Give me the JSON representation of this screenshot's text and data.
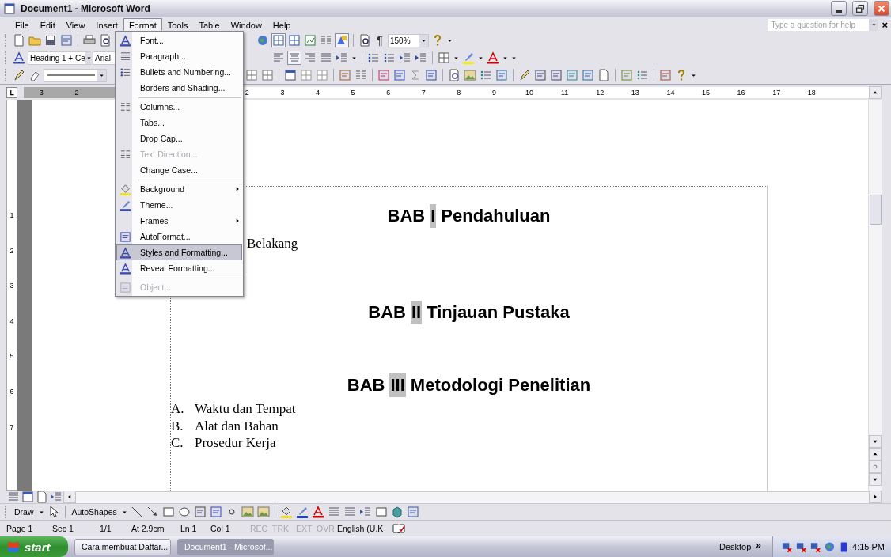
{
  "window": {
    "title": "Document1 - Microsoft Word"
  },
  "menu_bar": [
    {
      "label": "File",
      "selected": false
    },
    {
      "label": "Edit",
      "selected": false
    },
    {
      "label": "View",
      "selected": false
    },
    {
      "label": "Insert",
      "selected": false
    },
    {
      "label": "Format",
      "selected": true
    },
    {
      "label": "Tools",
      "selected": false
    },
    {
      "label": "Table",
      "selected": false
    },
    {
      "label": "Window",
      "selected": false
    },
    {
      "label": "Help",
      "selected": false
    }
  ],
  "help_box": {
    "placeholder": "Type a question for help",
    "close": "×"
  },
  "standard_toolbar": {
    "marks": "¶",
    "zoom": "150%"
  },
  "formatting_toolbar": {
    "style": "Heading 1 + Ce",
    "font": "Arial"
  },
  "format_menu": [
    {
      "label": "Font...",
      "disabled": false,
      "selected": false,
      "submenu": false,
      "separator_before": false
    },
    {
      "label": "Paragraph...",
      "disabled": false,
      "selected": false,
      "submenu": false,
      "separator_before": false
    },
    {
      "label": "Bullets and Numbering...",
      "disabled": false,
      "selected": false,
      "submenu": false,
      "separator_before": false
    },
    {
      "label": "Borders and Shading...",
      "disabled": false,
      "selected": false,
      "submenu": false,
      "separator_before": false
    },
    {
      "label": "Columns...",
      "disabled": false,
      "selected": false,
      "submenu": false,
      "separator_before": true
    },
    {
      "label": "Tabs...",
      "disabled": false,
      "selected": false,
      "submenu": false,
      "separator_before": false
    },
    {
      "label": "Drop Cap...",
      "disabled": false,
      "selected": false,
      "submenu": false,
      "separator_before": false
    },
    {
      "label": "Text Direction...",
      "disabled": true,
      "selected": false,
      "submenu": false,
      "separator_before": false
    },
    {
      "label": "Change Case...",
      "disabled": false,
      "selected": false,
      "submenu": false,
      "separator_before": false
    },
    {
      "label": "Background",
      "disabled": false,
      "selected": false,
      "submenu": true,
      "separator_before": true
    },
    {
      "label": "Theme...",
      "disabled": false,
      "selected": false,
      "submenu": false,
      "separator_before": false
    },
    {
      "label": "Frames",
      "disabled": false,
      "selected": false,
      "submenu": true,
      "separator_before": false
    },
    {
      "label": "AutoFormat...",
      "disabled": false,
      "selected": false,
      "submenu": false,
      "separator_before": false
    },
    {
      "label": "Styles and Formatting...",
      "disabled": false,
      "selected": true,
      "submenu": false,
      "separator_before": false
    },
    {
      "label": "Reveal Formatting...",
      "disabled": false,
      "selected": false,
      "submenu": false,
      "separator_before": false
    },
    {
      "label": "Object...",
      "disabled": true,
      "selected": false,
      "submenu": false,
      "separator_before": true
    }
  ],
  "ruler": {
    "left_labels": [
      "3",
      "2"
    ],
    "right_labels": [
      "2",
      "3",
      "4",
      "5",
      "6",
      "7",
      "8",
      "9",
      "10",
      "11",
      "12",
      "13",
      "14",
      "15",
      "16",
      "17",
      "18"
    ]
  },
  "vertical_ruler": [
    "1",
    "2",
    "3",
    "4",
    "5",
    "6",
    "7"
  ],
  "document": {
    "blocks": [
      {
        "kind": "heading",
        "prefix": "BAB",
        "numeral": "I",
        "title": "Pendahuluan"
      },
      {
        "kind": "fragment",
        "text": "Belakang"
      },
      {
        "kind": "heading",
        "prefix": "BAB",
        "numeral": "II",
        "title": "Tinjauan Pustaka"
      },
      {
        "kind": "heading",
        "prefix": "BAB",
        "numeral": "III",
        "title": "Metodologi Penelitian"
      },
      {
        "kind": "list",
        "items": [
          {
            "marker": "A.",
            "text": "Waktu dan Tempat"
          },
          {
            "marker": "B.",
            "text": "Alat dan Bahan"
          },
          {
            "marker": "C.",
            "text": "Prosedur Kerja"
          }
        ]
      }
    ]
  },
  "draw_toolbar": {
    "draw": "Draw",
    "autoshapes": "AutoShapes"
  },
  "status_bar": [
    {
      "text": "Page 1",
      "disabled": false
    },
    {
      "text": "Sec 1",
      "disabled": false
    },
    {
      "text": "1/1",
      "disabled": false
    },
    {
      "text": "At 2.9cm",
      "disabled": false
    },
    {
      "text": "Ln 1",
      "disabled": false
    },
    {
      "text": "Col 1",
      "disabled": false
    },
    {
      "text": "REC",
      "disabled": true
    },
    {
      "text": "TRK",
      "disabled": true
    },
    {
      "text": "EXT",
      "disabled": true
    },
    {
      "text": "OVR",
      "disabled": true
    },
    {
      "text": "English (U.K",
      "disabled": false
    }
  ],
  "taskbar": {
    "start": "start",
    "tasks": [
      {
        "label": "Cara membuat Daftar...",
        "selected": false
      },
      {
        "label": "Document1 - Microsof...",
        "selected": true
      }
    ],
    "desktop": "Desktop",
    "chevron": "»",
    "clock": "4:15 PM"
  }
}
